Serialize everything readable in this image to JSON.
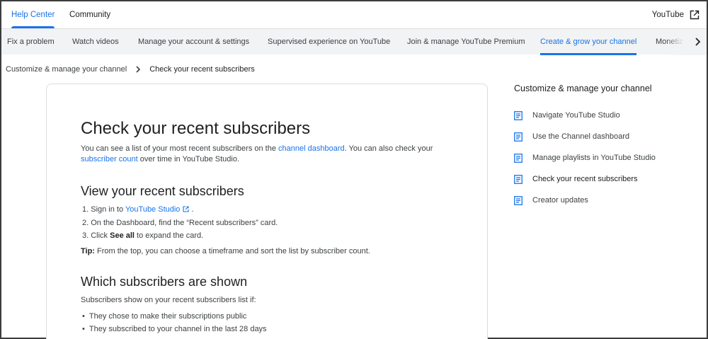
{
  "top_tabs": [
    {
      "label": "Help Center"
    },
    {
      "label": "Community"
    }
  ],
  "product": {
    "label": "YouTube"
  },
  "nav": {
    "items": [
      {
        "label": "Fix a problem"
      },
      {
        "label": "Watch videos"
      },
      {
        "label": "Manage your account & settings"
      },
      {
        "label": "Supervised experience on YouTube"
      },
      {
        "label": "Join & manage YouTube Premium"
      },
      {
        "label": "Create & grow your channel"
      },
      {
        "label": "Monetize"
      }
    ],
    "active": "Create & grow your channel"
  },
  "breadcrumb": {
    "parent": "Customize & manage your channel",
    "current": "Check your recent subscribers"
  },
  "article": {
    "title": "Check your recent subscribers",
    "intro": {
      "t1": "You can see a list of your most recent subscribers on the ",
      "link1": "channel dashboard",
      "t2": ". You can also check your",
      "link2": "subscriber count",
      "t3": " over time in YouTube Studio."
    },
    "section1": {
      "heading": "View your recent subscribers",
      "step1_prefix": "1. Sign in to ",
      "step1_link": "YouTube Studio",
      "step1_suffix": " .",
      "step2": "2. On the Dashboard, find the “Recent subscribers” card.",
      "step3_prefix": "3. Click ",
      "step3_bold": "See all",
      "step3_suffix": " to expand the card.",
      "tip_label": "Tip:",
      "tip_text": " From the top, you can choose a timeframe and sort the list by subscriber count."
    },
    "section2": {
      "heading": "Which subscribers are shown",
      "lead": "Subscribers show on your recent subscribers list if:",
      "bullets": [
        "They chose to make their subscriptions public",
        "They subscribed to your channel in the last 28 days"
      ]
    }
  },
  "sidebar": {
    "title": "Customize & manage your channel",
    "items": [
      {
        "label": "Navigate YouTube Studio"
      },
      {
        "label": "Use the Channel dashboard"
      },
      {
        "label": "Manage playlists in YouTube Studio"
      },
      {
        "label": "Check your recent subscribers"
      },
      {
        "label": "Creator updates"
      }
    ]
  },
  "colors": {
    "accent": "#1a73e8",
    "nav_bg": "#f1f3f4",
    "text": "#202124"
  }
}
